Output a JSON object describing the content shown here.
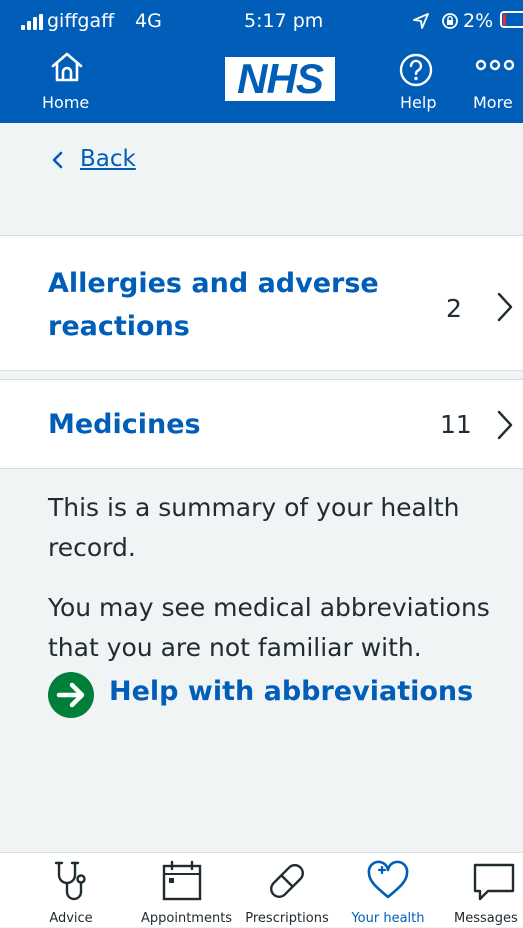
{
  "status_bar": {
    "carrier": "giffgaff",
    "network": "4G",
    "time": "5:17 pm",
    "battery": "2%",
    "icons": [
      "signal-icon",
      "location-arrow-icon",
      "rotation-lock-icon",
      "battery-icon"
    ]
  },
  "header": {
    "home_label": "Home",
    "logo": "NHS",
    "help_label": "Help",
    "more_label": "More",
    "icons": [
      "home-icon",
      "question-circle-icon",
      "more-dots-icon"
    ],
    "colors": {
      "header_bg": "#005eb8",
      "text": "#ffffff"
    }
  },
  "back": {
    "label": "Back",
    "icon": "chevron-left-icon"
  },
  "sections": [
    {
      "title_line1": "Allergies and adverse",
      "title_line2": "reactions",
      "count": "2",
      "icon": "chevron-right-icon"
    },
    {
      "title_line1": "Medicines",
      "title_line2": "",
      "count": "11",
      "icon": "chevron-right-icon"
    }
  ],
  "info": {
    "paragraph1_line1": "This is a summary of your health",
    "paragraph1_line2": "record.",
    "paragraph2_line1": "You may see medical abbreviations",
    "paragraph2_line2": "that you are not familiar with."
  },
  "help_link": {
    "label": "Help with abbreviations",
    "icon": "arrow-right-circle-icon",
    "color": "#007f3b"
  },
  "tabs": [
    {
      "label": "Advice",
      "icon": "stethoscope-icon",
      "active": false
    },
    {
      "label": "Appointments",
      "icon": "calendar-icon",
      "active": false
    },
    {
      "label": "Prescriptions",
      "icon": "pill-icon",
      "active": false
    },
    {
      "label": "Your health",
      "icon": "heart-plus-icon",
      "active": true
    },
    {
      "label": "Messages",
      "icon": "speech-bubble-icon",
      "active": false
    }
  ],
  "colors": {
    "nhs_blue": "#005eb8",
    "background": "#f0f4f5",
    "text": "#212b32",
    "green": "#007f3b"
  }
}
